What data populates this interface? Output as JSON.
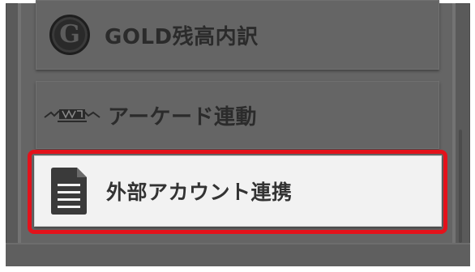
{
  "menu": {
    "items": [
      {
        "label": "GOLD残高内訳",
        "icon": "gold-coin-icon"
      },
      {
        "label": "アーケード連動",
        "icon": "arcade-logo-icon"
      },
      {
        "label": "外部アカウント連携",
        "icon": "document-icon"
      }
    ],
    "gold_icon_letter": "G"
  },
  "colors": {
    "background": "#5a5a5a",
    "item_bg": "#656565",
    "selected_item_bg": "#f2f2f2",
    "highlight": "#e3121b",
    "text": "#2b2b2b"
  }
}
